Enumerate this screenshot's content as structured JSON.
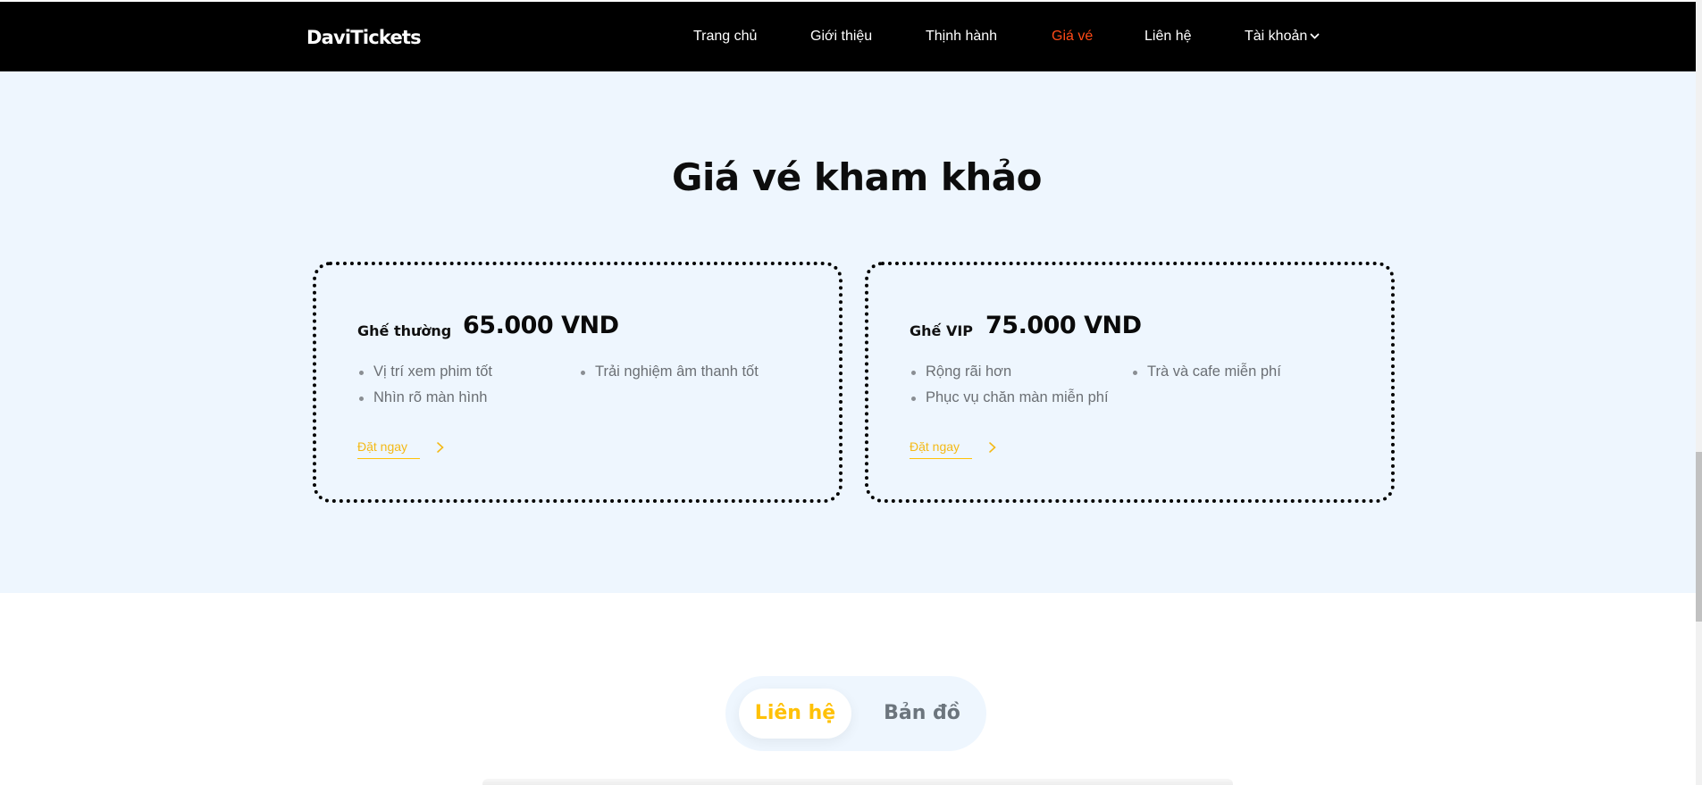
{
  "header": {
    "logo": "DaviTickets",
    "nav": [
      {
        "label": "Trang chủ"
      },
      {
        "label": "Giới thiệu"
      },
      {
        "label": "Thịnh hành"
      },
      {
        "label": "Giá vé"
      },
      {
        "label": "Liên hệ"
      },
      {
        "label": "Tài khoản"
      }
    ],
    "active_index": 3,
    "account_icon": "chevron-down-icon"
  },
  "pricing": {
    "title": "Giá vé kham khảo",
    "cards": [
      {
        "seat": "Ghế thường",
        "price": "65.000 VND",
        "features": [
          "Vị trí xem phim tốt",
          "Trải nghiệm âm thanh tốt",
          "Nhìn rõ màn hình"
        ],
        "cta": "Đặt ngay"
      },
      {
        "seat": "Ghế VIP",
        "price": "75.000 VND",
        "features": [
          "Rộng rãi hơn",
          "Trà và cafe miễn phí",
          "Phục vụ chăn màn miễn phí"
        ],
        "cta": "Đặt ngay"
      }
    ],
    "cta_icon": "chevron-right-icon"
  },
  "tabs": {
    "items": [
      {
        "label": "Liên hệ"
      },
      {
        "label": "Bản đồ"
      }
    ],
    "active_index": 0
  },
  "colors": {
    "header_bg": "#000000",
    "active_nav": "#ff4a17",
    "section_bg": "#eef6fe",
    "accent": "#ffc107",
    "muted_text": "#6b6f74"
  }
}
